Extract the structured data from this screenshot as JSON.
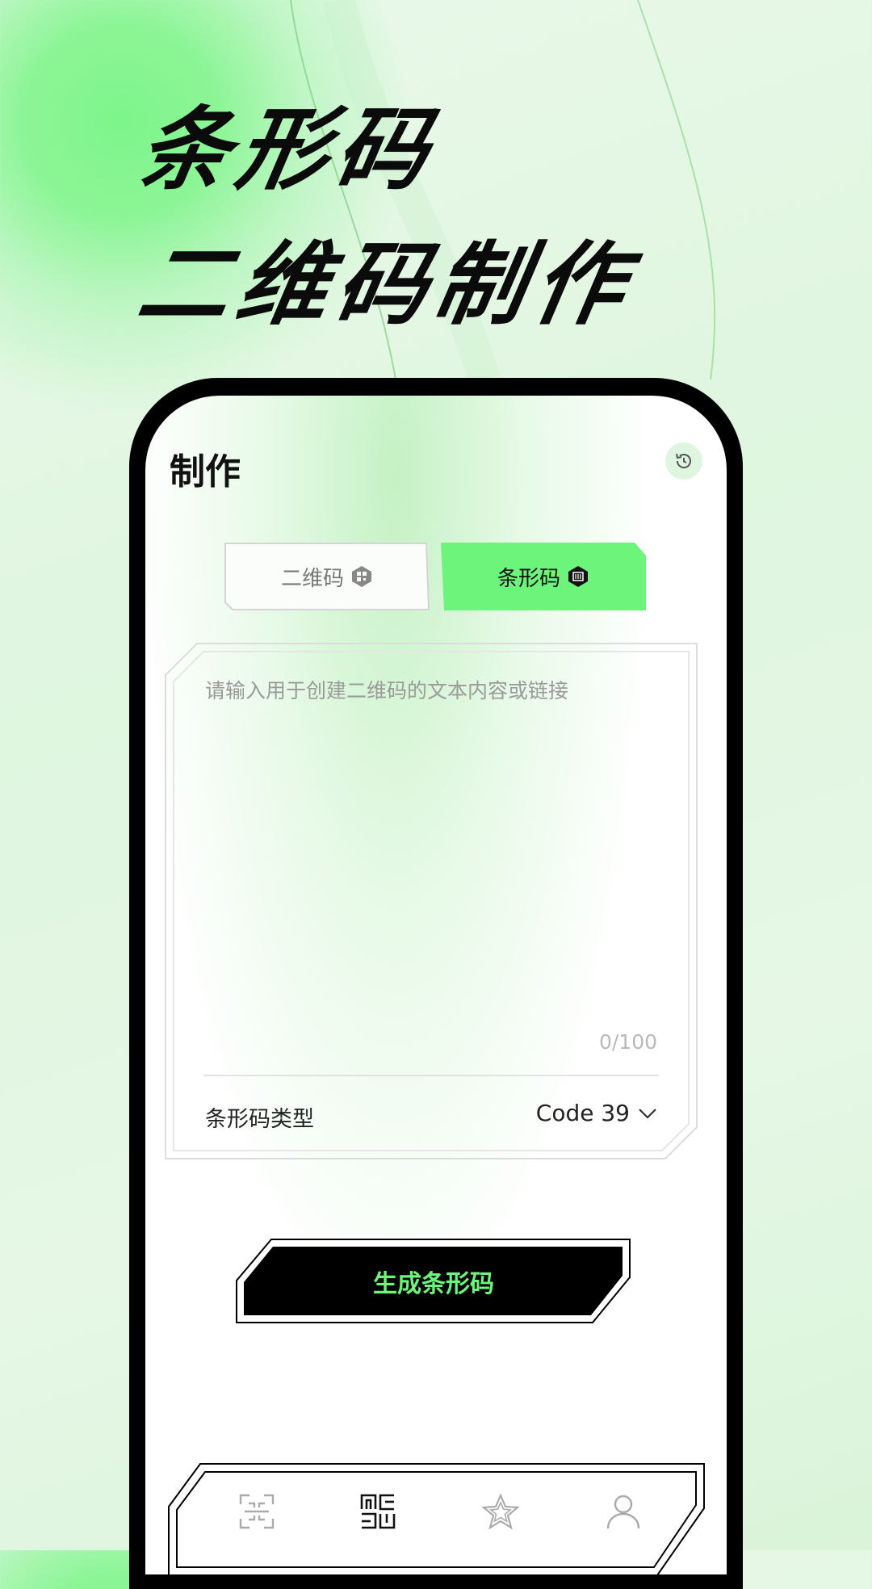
{
  "hero": {
    "line1": "条形码",
    "line2": "二维码制作"
  },
  "header": {
    "title": "制作",
    "history_icon": "history-icon"
  },
  "tabs": [
    {
      "label": "二维码",
      "icon": "qr-code-icon",
      "active": false
    },
    {
      "label": "条形码",
      "icon": "barcode-icon",
      "active": true
    }
  ],
  "input": {
    "placeholder": "请输入用于创建二维码的文本内容或链接",
    "value": "",
    "counter": "0/100"
  },
  "barcode_type": {
    "label": "条形码类型",
    "selected": "Code 39"
  },
  "generate_button": {
    "label": "生成条形码"
  },
  "bottom_nav": [
    {
      "icon": "scan-icon",
      "active": false
    },
    {
      "icon": "qr-create-icon",
      "active": true
    },
    {
      "icon": "star-icon",
      "active": false
    },
    {
      "icon": "profile-icon",
      "active": false
    }
  ],
  "colors": {
    "accent_green": "#6cf57a",
    "black": "#000000",
    "background": "#e3f6e3"
  }
}
